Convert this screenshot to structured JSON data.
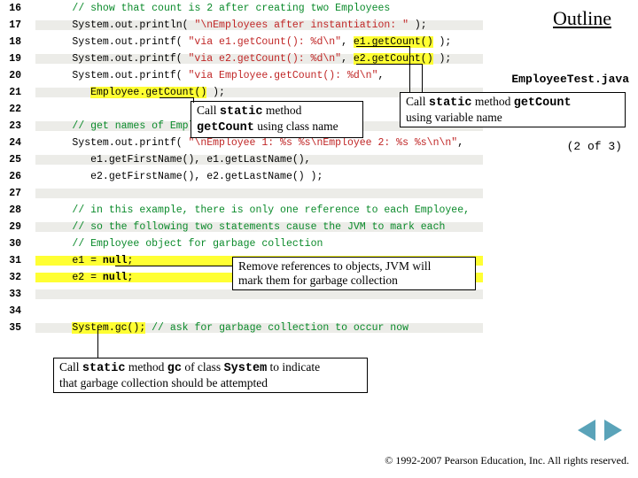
{
  "outline_title": "Outline",
  "filelabel": "EmployeeTest.java",
  "pager": "(2 of  3)",
  "copyright": "© 1992-2007 Pearson Education, Inc.  All rights reserved.",
  "callouts": {
    "a": {
      "line1_pre": "Call ",
      "line1_code": "static",
      "line1_mid": " method ",
      "line1_code2": "getCount",
      "line2": "using variable name"
    },
    "b": {
      "line1_pre": "Call ",
      "line1_code": "static",
      "line1_post": " method",
      "line2_code": "getCount",
      "line2_post": " using class name"
    },
    "c": {
      "line1": "Remove references to objects, JVM will",
      "line2": "mark them for garbage collection"
    },
    "d": {
      "line1_pre": "Call ",
      "line1_code": "static",
      "line1_mid": " method ",
      "line1_code2": "gc",
      "line1_mid2": " of class ",
      "line1_code3": "System",
      "line1_post": " to indicate",
      "line2": "that garbage collection should be attempted"
    }
  },
  "lines": [
    {
      "n": "16",
      "html": "      <span class='c'>// show that count is 2 after creating two Employees</span>"
    },
    {
      "n": "17",
      "html": "<span class='row'>      System.out.println( <span class='str'>\"\\nEmployees after instantiation: \"</span> );</span>"
    },
    {
      "n": "18",
      "html": "      System.out.printf( <span class='str'>\"via e1.getCount(): %d\\n\"</span>, <span class='hl'>e1.getCount()</span> );"
    },
    {
      "n": "19",
      "html": "<span class='row'>      System.out.printf( <span class='str'>\"via e2.getCount(): %d\\n\"</span>, <span class='hl'>e2.getCount()</span> );</span>"
    },
    {
      "n": "20",
      "html": "      System.out.printf( <span class='str'>\"via Employee.getCount(): %d\\n\"</span>,"
    },
    {
      "n": "21",
      "html": "<span class='row'>         <span class='hl'>Employee.getCount()</span> );</span>"
    },
    {
      "n": "22",
      "html": ""
    },
    {
      "n": "23",
      "html": "<span class='row'>      <span class='c'>// get names of Employees</span></span>"
    },
    {
      "n": "24",
      "html": "      System.out.printf( <span class='str'>\"\\nEmployee 1: %s %s\\nEmployee 2: %s %s\\n\\n\"</span>,"
    },
    {
      "n": "25",
      "html": "<span class='row'>         e1.getFirstName(), e1.getLastName(),</span>"
    },
    {
      "n": "26",
      "html": "         e2.getFirstName(), e2.getLastName() );"
    },
    {
      "n": "27",
      "html": "<span class='row'> </span>"
    },
    {
      "n": "28",
      "html": "      <span class='c'>// in this example, there is only one reference to each Employee,</span>"
    },
    {
      "n": "29",
      "html": "<span class='row'>      <span class='c'>// so the following two statements cause the JVM to mark each</span></span>"
    },
    {
      "n": "30",
      "html": "      <span class='c'>// Employee object for garbage collection</span>"
    },
    {
      "n": "31",
      "html": "<span class='rowy'>      e1 = <span class='id'>null</span>;</span>"
    },
    {
      "n": "32",
      "html": "<span class='rowy'>      e2 = <span class='id'>null</span>;</span>"
    },
    {
      "n": "33",
      "html": "<span class='row'> </span>"
    },
    {
      "n": "34",
      "html": ""
    },
    {
      "n": "35",
      "html": "<span class='row'>      <span class='hl'>System.gc();</span> <span class='c'>// ask for garbage collection to occur now</span></span>"
    }
  ]
}
